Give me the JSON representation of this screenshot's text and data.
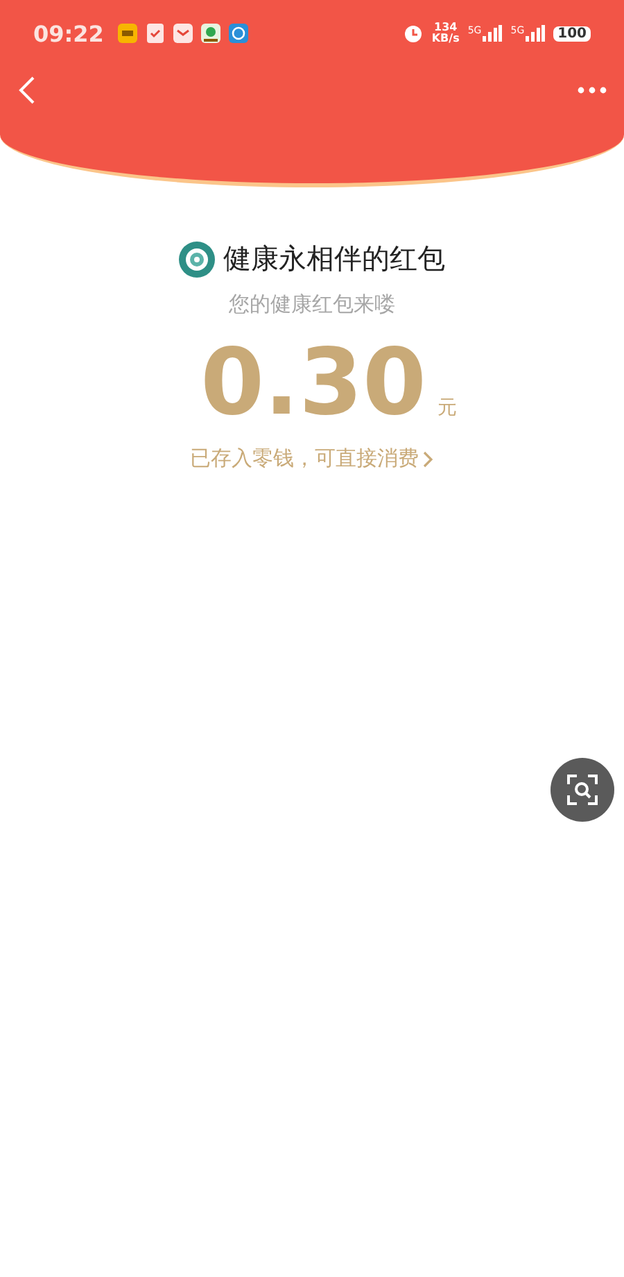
{
  "status_bar": {
    "time": "09:22",
    "network_speed": "134",
    "network_speed_unit": "KB/s",
    "signal_labels": [
      "5G",
      "5G"
    ],
    "battery": "100"
  },
  "title": "健康永相伴的红包",
  "subtitle": "您的健康红包来喽",
  "amount": "0.30",
  "currency": "元",
  "note": "已存入零钱，可直接消费"
}
